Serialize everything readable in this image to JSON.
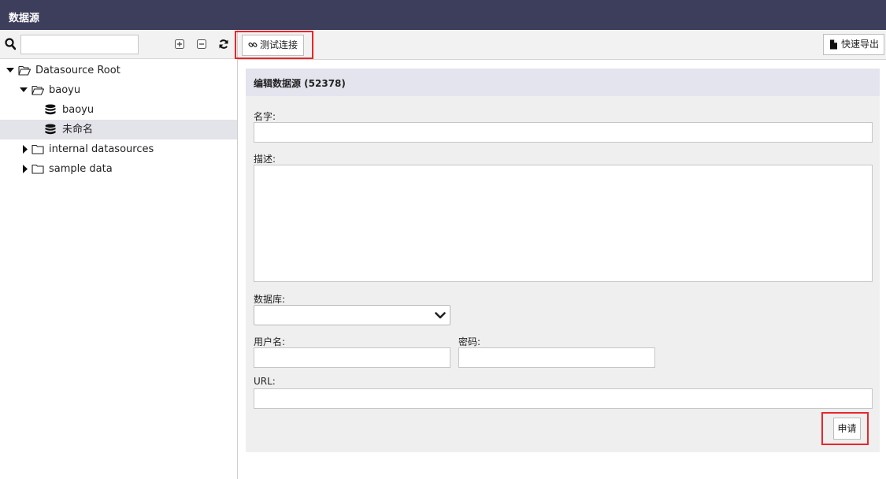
{
  "window": {
    "title": "数据源"
  },
  "left_toolbar": {
    "search_value": "",
    "icons": [
      "search-icon",
      "expand-all-icon",
      "collapse-all-icon",
      "refresh-icon"
    ]
  },
  "tree": {
    "items": [
      {
        "label": "Datasource Root",
        "expanded": true,
        "icon": "folder-open-icon"
      },
      {
        "label": "baoyu",
        "expanded": true,
        "icon": "folder-open-icon"
      },
      {
        "label": "baoyu",
        "icon": "database-icon"
      },
      {
        "label": "未命名",
        "icon": "database-icon",
        "selected": true
      },
      {
        "label": "internal datasources",
        "expanded": false,
        "icon": "folder-icon"
      },
      {
        "label": "sample data",
        "expanded": false,
        "icon": "folder-icon"
      }
    ]
  },
  "toolbar": {
    "test_connection_label": "测试连接",
    "quick_export_label": "快速导出"
  },
  "form": {
    "header": "编辑数据源 (52378)",
    "name_label": "名字:",
    "name_value": "",
    "description_label": "描述:",
    "description_value": "",
    "database_label": "数据库:",
    "database_value": "",
    "username_label": "用户名:",
    "username_value": "",
    "password_label": "密码:",
    "password_value": "",
    "url_label": "URL:",
    "url_value": "",
    "apply_label": "申请"
  },
  "colors": {
    "titlebar": "#3d3d5c",
    "highlight": "#e8262a",
    "panel_header": "#e4e4ee",
    "selected_row": "#e3e3ea"
  }
}
